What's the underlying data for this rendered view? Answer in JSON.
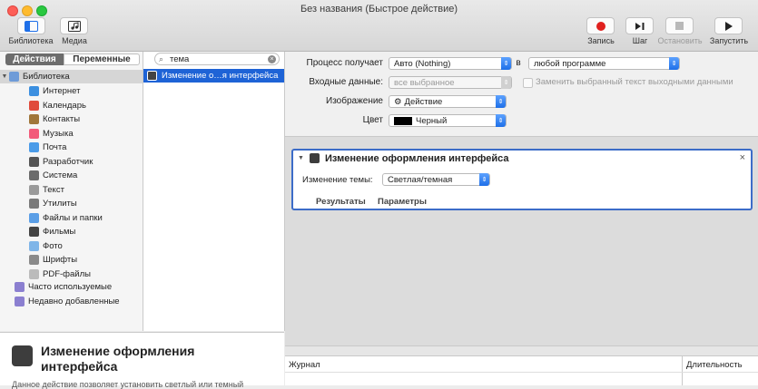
{
  "window": {
    "title": "Без названия (Быстрое действие)"
  },
  "toolbar": {
    "library_label": "Библиотека",
    "media_label": "Медиа",
    "record_label": "Запись",
    "step_label": "Шаг",
    "stop_label": "Остановить",
    "run_label": "Запустить"
  },
  "library": {
    "segment_actions": "Действия",
    "segment_variables": "Переменные",
    "search_value": "тема",
    "root_label": "Библиотека",
    "items": [
      {
        "label": "Интернет",
        "color": "#3b8fe0"
      },
      {
        "label": "Календарь",
        "color": "#e04a3b"
      },
      {
        "label": "Контакты",
        "color": "#a0763a"
      },
      {
        "label": "Музыка",
        "color": "#f25b7a"
      },
      {
        "label": "Почта",
        "color": "#4a9be8"
      },
      {
        "label": "Разработчик",
        "color": "#555555"
      },
      {
        "label": "Система",
        "color": "#6b6b6b"
      },
      {
        "label": "Текст",
        "color": "#9a9a9a"
      },
      {
        "label": "Утилиты",
        "color": "#7a7a7a"
      },
      {
        "label": "Файлы и папки",
        "color": "#5a9ee6"
      },
      {
        "label": "Фильмы",
        "color": "#444444"
      },
      {
        "label": "Фото",
        "color": "#7fb5e8"
      },
      {
        "label": "Шрифты",
        "color": "#8a8a8a"
      },
      {
        "label": "PDF-файлы",
        "color": "#bbbbbb"
      }
    ],
    "smart": [
      {
        "label": "Часто используемые"
      },
      {
        "label": "Недавно добавленные"
      }
    ],
    "result_label": "Изменение о…я интерфейса"
  },
  "description": {
    "title": "Изменение оформления интерфейса",
    "text": "Данное действие позволяет установить светлый или темный"
  },
  "workflow": {
    "receives_label": "Процесс получает",
    "receives_value": "Авто (Nothing)",
    "in_label": "в",
    "app_value": "любой программе",
    "input_label": "Входные данные:",
    "input_value": "все выбранное",
    "replace_label": "Заменить выбранный текст выходными данными",
    "image_label": "Изображение",
    "image_value": "Действие",
    "color_label": "Цвет",
    "color_value": "Черный",
    "color_swatch": "#000000"
  },
  "action": {
    "title": "Изменение оформления интерфейса",
    "theme_label": "Изменение темы:",
    "theme_value": "Светлая/темная",
    "results_tab": "Результаты",
    "params_tab": "Параметры"
  },
  "log": {
    "col_journal": "Журнал",
    "col_duration": "Длительность"
  },
  "colors": {
    "accent": "#1e6fe8",
    "selection": "#1e63d6",
    "record": "#e0201e"
  }
}
